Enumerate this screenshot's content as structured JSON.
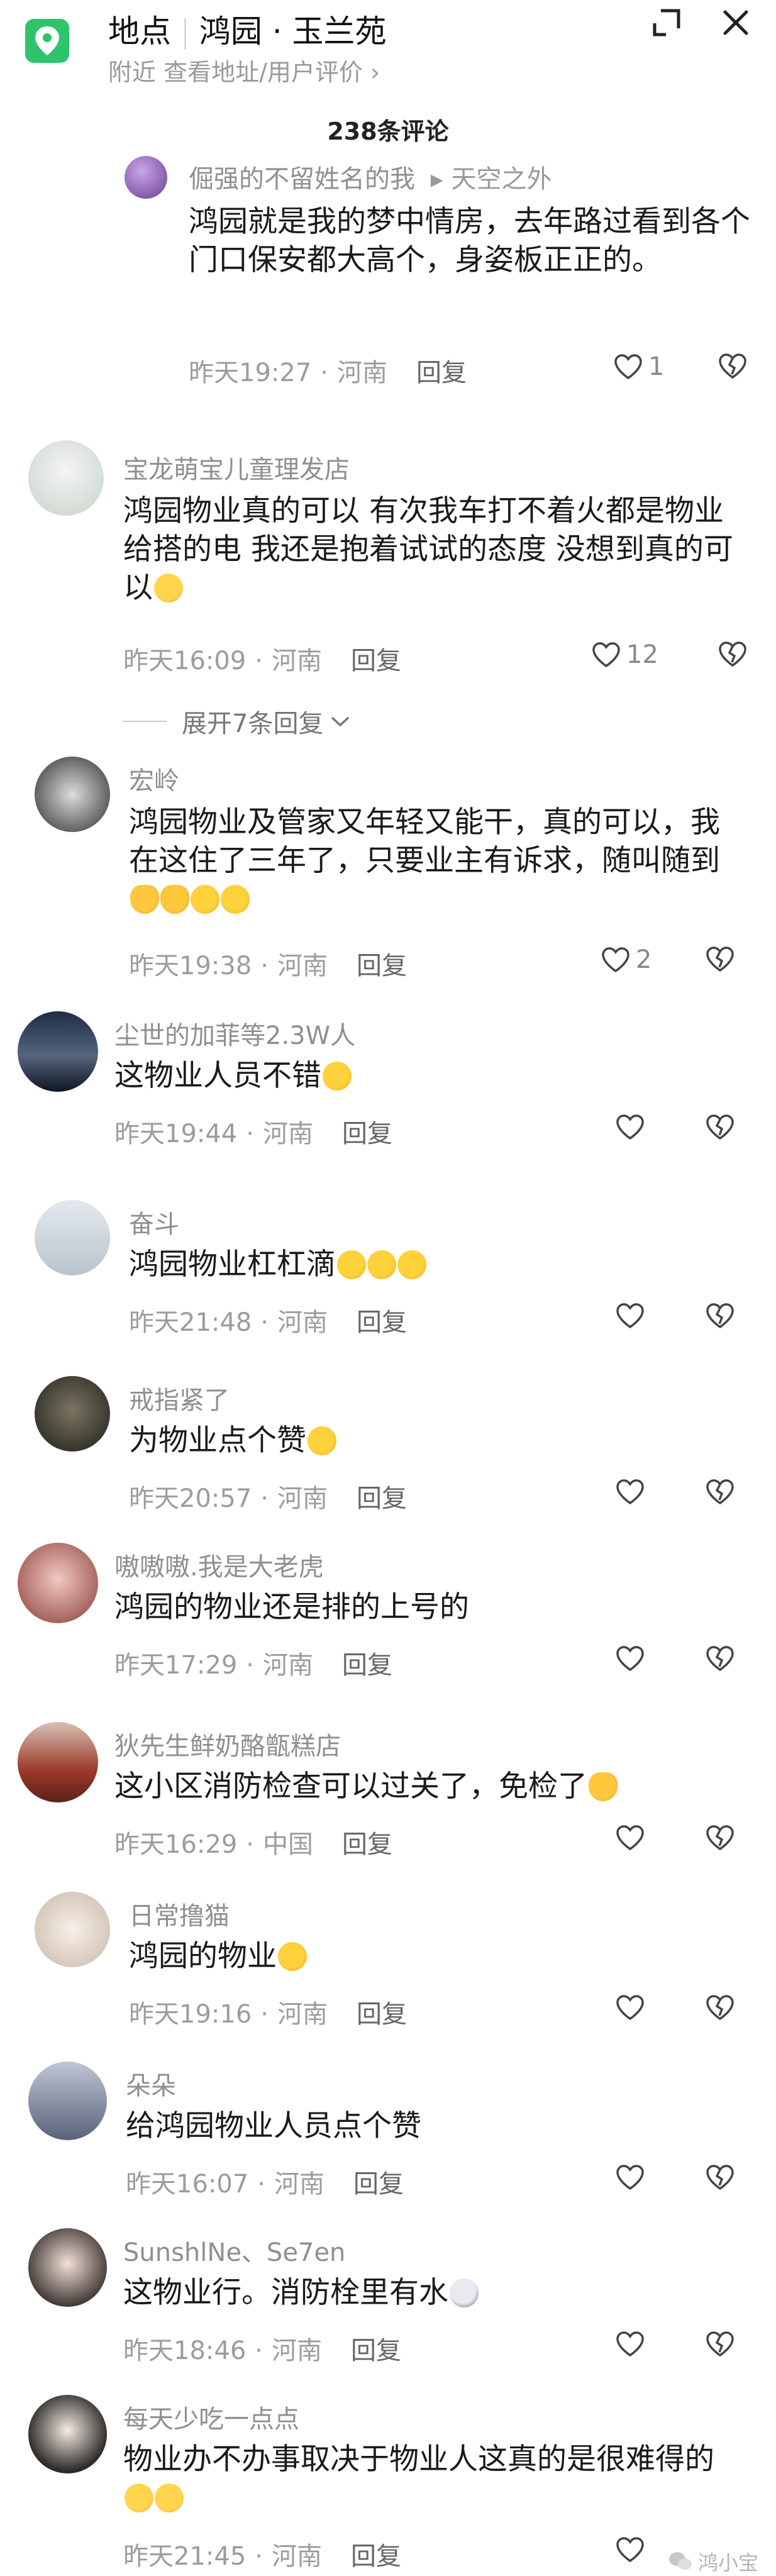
{
  "header": {
    "title_main": "地点",
    "title_place": "鸿园 · 玉兰苑",
    "subtitle": "附近  查看地址/用户评价 ›"
  },
  "comment_count": "238条评论",
  "comments": [
    {
      "user": "倔强的不留姓名的我",
      "reply_to": "▸ 天空之外",
      "text": "鸿园就是我的梦中情房，去年路过看到各个门口保安都大高个，身姿板正正的。",
      "time": "昨天19:27",
      "region": "河南",
      "reply": "回复",
      "likes": "1"
    },
    {
      "user": "宝龙萌宝儿童理发店",
      "text": "鸿园物业真的可以  有次我车打不着火都是物业给搭的电  我还是抱着试试的态度  没想到真的可以",
      "time": "昨天16:09",
      "region": "河南",
      "reply": "回复",
      "likes": "12",
      "expand": "展开7条回复"
    },
    {
      "user": "宏岭",
      "text": "鸿园物业及管家又年轻又能干，真的可以，我在这住了三年了，只要业主有诉求，随叫随到",
      "time": "昨天19:38",
      "region": "河南",
      "reply": "回复",
      "likes": "2"
    },
    {
      "user": "尘世的加菲等2.3W人",
      "text": "这物业人员不错",
      "time": "昨天19:44",
      "region": "河南",
      "reply": "回复",
      "likes": ""
    },
    {
      "user": "奋斗",
      "text": "鸿园物业杠杠滴",
      "time": "昨天21:48",
      "region": "河南",
      "reply": "回复",
      "likes": ""
    },
    {
      "user": "戒指紧了",
      "text": "为物业点个赞",
      "time": "昨天20:57",
      "region": "河南",
      "reply": "回复",
      "likes": ""
    },
    {
      "user": "嗷嗷嗷.我是大老虎",
      "text": "鸿园的物业还是排的上号的",
      "time": "昨天17:29",
      "region": "河南",
      "reply": "回复",
      "likes": ""
    },
    {
      "user": "狄先生鲜奶酪甑糕店",
      "text": "这小区消防检查可以过关了，免检了",
      "time": "昨天16:29",
      "region": "中国",
      "reply": "回复",
      "likes": ""
    },
    {
      "user": "日常撸猫",
      "text": "鸿园的物业",
      "time": "昨天19:16",
      "region": "河南",
      "reply": "回复",
      "likes": ""
    },
    {
      "user": "朵朵",
      "text": "给鸿园物业人员点个赞",
      "time": "昨天16:07",
      "region": "河南",
      "reply": "回复",
      "likes": ""
    },
    {
      "user": "SunshlNe、Se7en",
      "text": "这物业行。消防栓里有水",
      "time": "昨天18:46",
      "region": "河南",
      "reply": "回复",
      "likes": ""
    },
    {
      "user": "每天少吃一点点",
      "text": "物业办不办事取决于物业人这真的是很难得的",
      "time": "昨天21:45",
      "region": "河南",
      "reply": "回复",
      "likes": ""
    }
  ],
  "watermark": "鸿小宝",
  "colors": {
    "accent": "#2fc46b",
    "meta": "#9c9c9c"
  }
}
